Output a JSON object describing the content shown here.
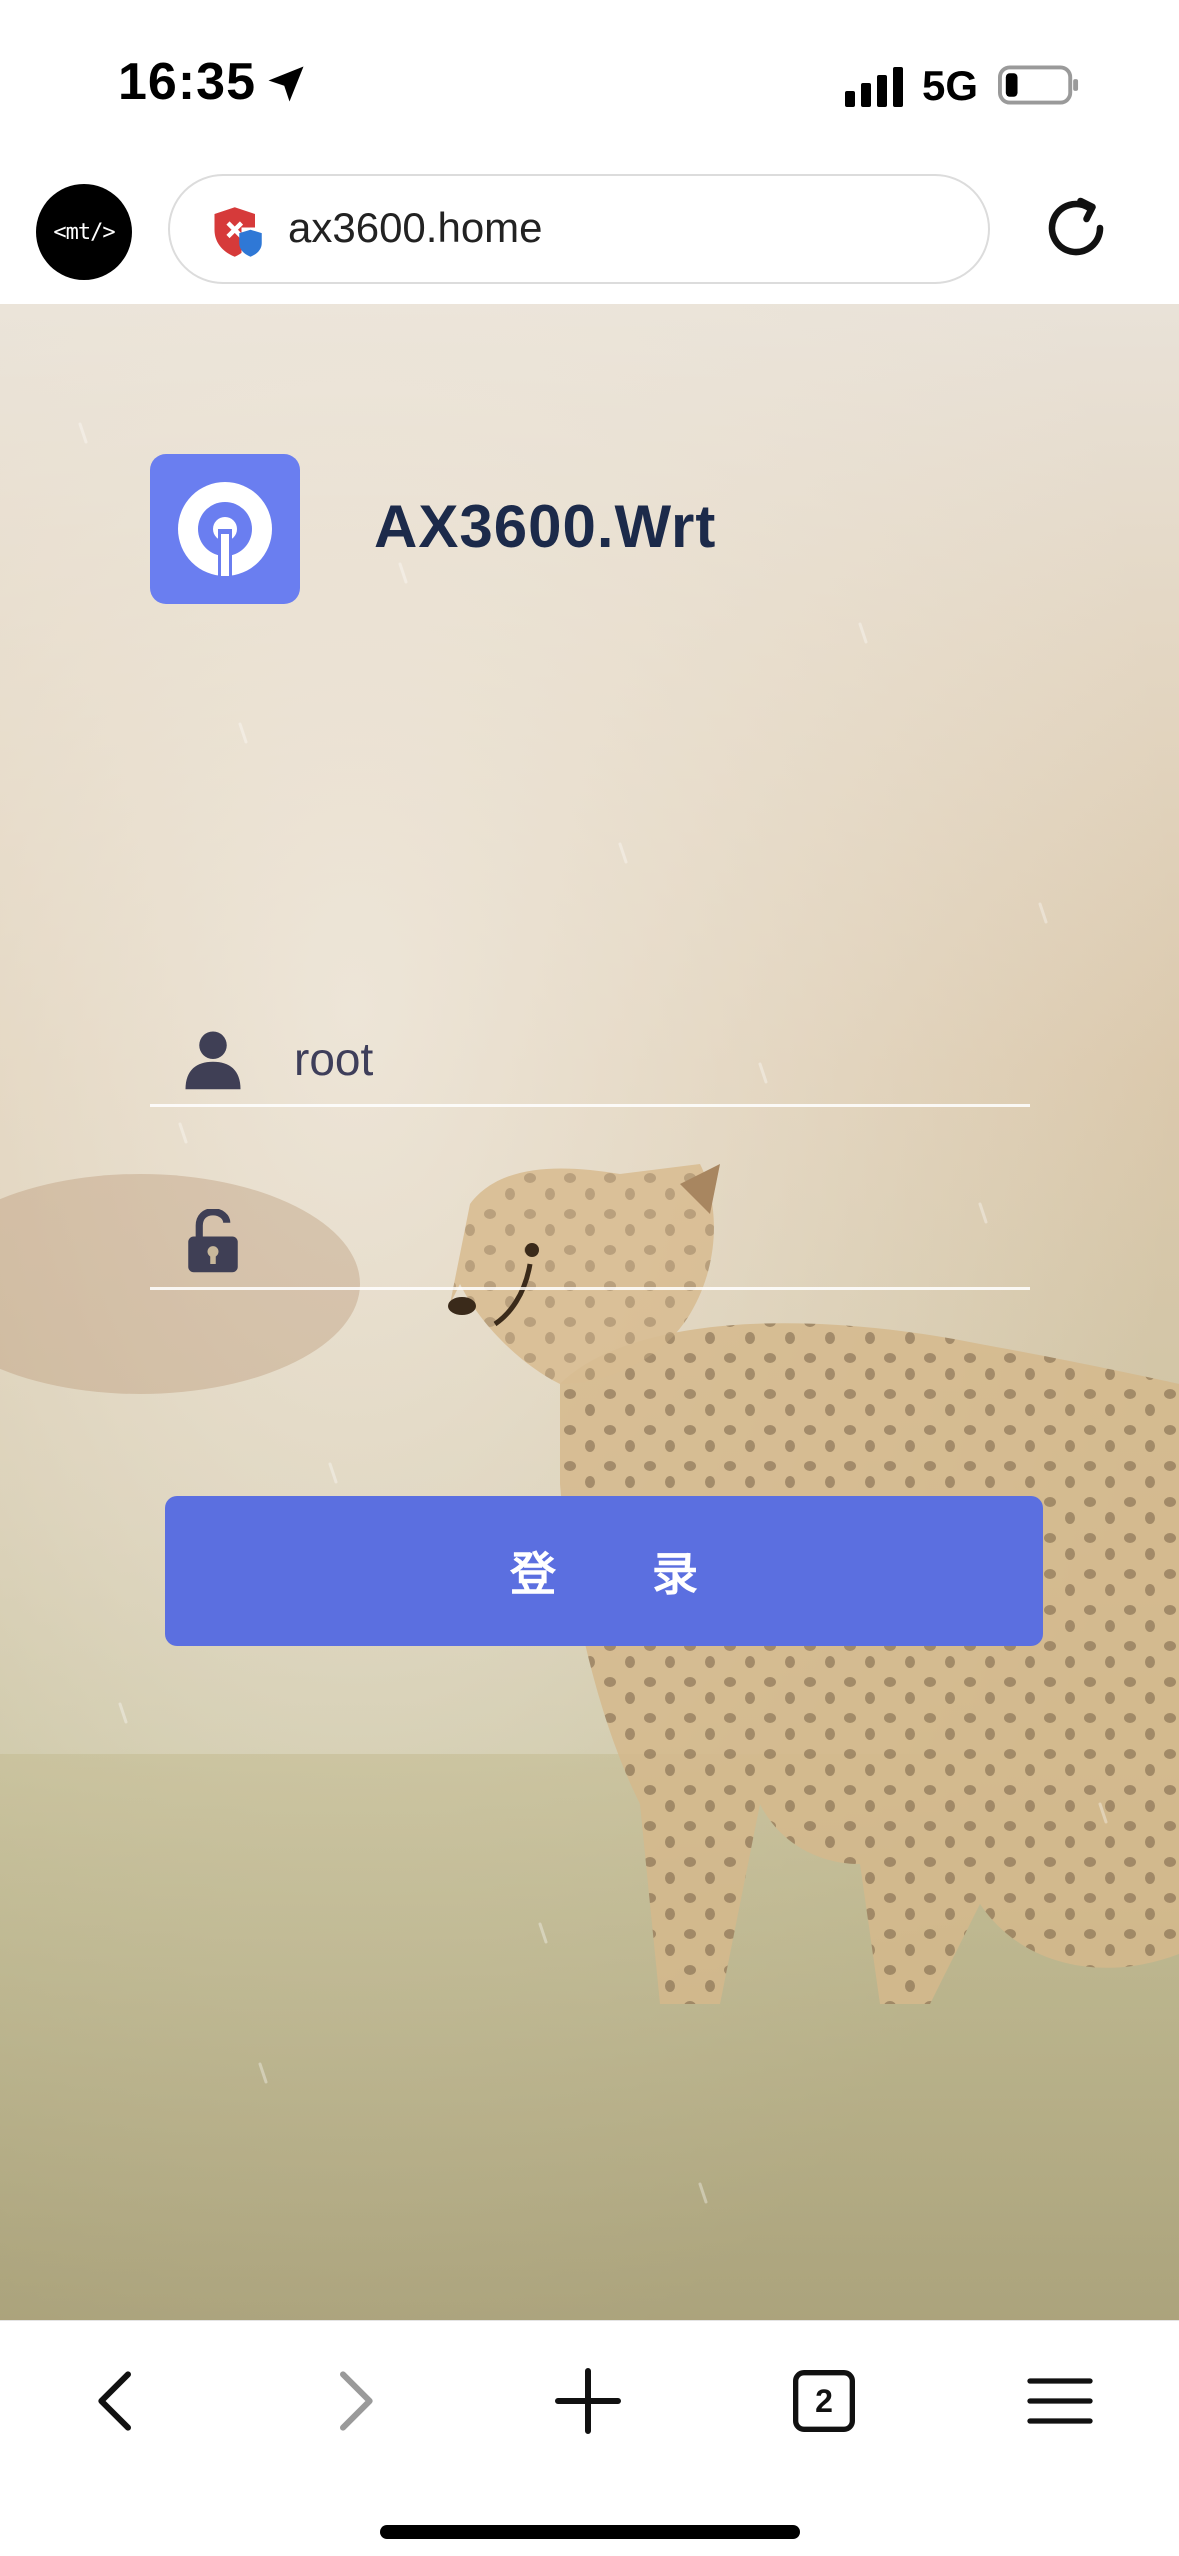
{
  "status_bar": {
    "time": "16:35",
    "network": "5G",
    "icons": [
      "location-arrow-icon",
      "signal-icon",
      "battery-icon"
    ]
  },
  "browser": {
    "dev_tools_label": "<mt/>",
    "url": "ax3600.home",
    "security_icon": "shield-icon",
    "reload_icon": "reload-icon",
    "tab_count": "2",
    "nav": [
      "back-icon",
      "forward-icon",
      "new-tab-icon",
      "tabs-icon",
      "menu-icon"
    ]
  },
  "login": {
    "brand": "AX3600.Wrt",
    "username_value": "root",
    "password_value": "",
    "button_label": "登 录",
    "accent_color": "#5b6fe0"
  }
}
